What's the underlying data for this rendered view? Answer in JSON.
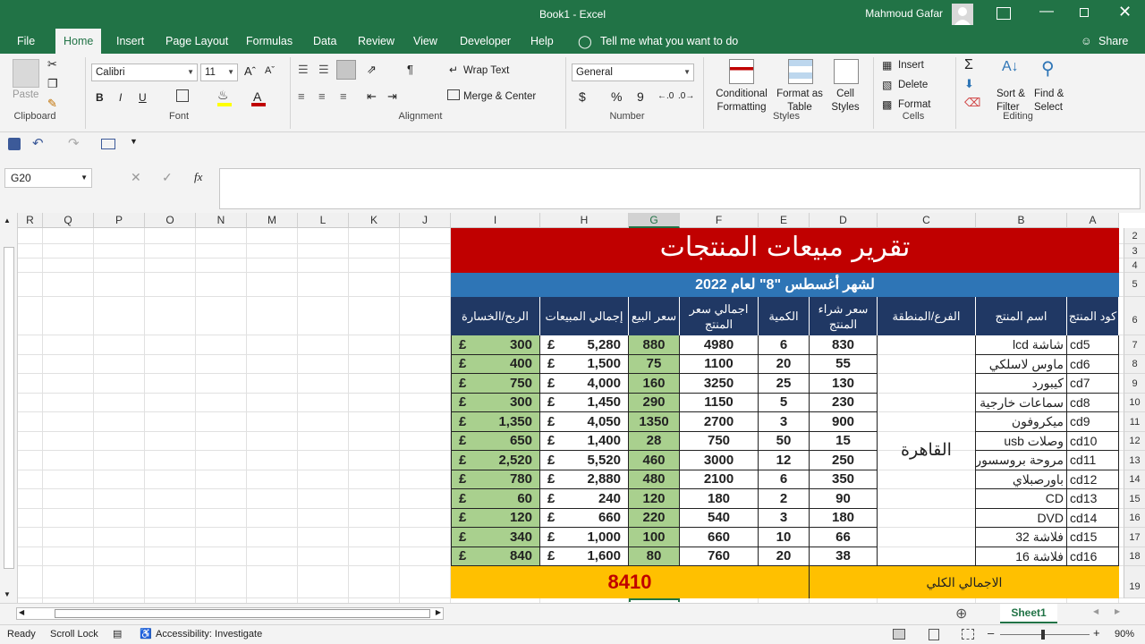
{
  "window": {
    "title": "Book1  -  Excel",
    "user": "Mahmoud Gafar"
  },
  "tabs": [
    "File",
    "Home",
    "Insert",
    "Page Layout",
    "Formulas",
    "Data",
    "Review",
    "View",
    "Developer",
    "Help"
  ],
  "tell_me": "Tell me what you want to do",
  "share": "Share",
  "ribbon": {
    "clipboard": {
      "label": "Clipboard",
      "paste": "Paste"
    },
    "font": {
      "label": "Font",
      "name": "Calibri",
      "size": "11",
      "bold": "B",
      "italic": "I",
      "underline": "U"
    },
    "alignment": {
      "label": "Alignment",
      "wrap": "Wrap Text",
      "merge": "Merge & Center"
    },
    "number": {
      "label": "Number",
      "format": "General",
      "currency": "$",
      "percent": "%",
      "comma": "9"
    },
    "styles": {
      "label": "Styles",
      "conditional": [
        "Conditional",
        "Formatting"
      ],
      "format_table": [
        "Format as",
        "Table"
      ],
      "cell_styles": [
        "Cell",
        "Styles"
      ]
    },
    "cells": {
      "label": "Cells",
      "insert": "Insert",
      "delete": "Delete",
      "format": "Format"
    },
    "editing": {
      "label": "Editing",
      "sort": [
        "Sort &",
        "Filter"
      ],
      "find": [
        "Find &",
        "Select"
      ]
    }
  },
  "name_box": "G20",
  "fx": "fx",
  "columns": [
    {
      "id": "R",
      "w": 28
    },
    {
      "id": "Q",
      "w": 57
    },
    {
      "id": "P",
      "w": 57
    },
    {
      "id": "O",
      "w": 57
    },
    {
      "id": "N",
      "w": 57
    },
    {
      "id": "M",
      "w": 57
    },
    {
      "id": "L",
      "w": 57
    },
    {
      "id": "K",
      "w": 57
    },
    {
      "id": "J",
      "w": 57
    },
    {
      "id": "I",
      "w": 100
    },
    {
      "id": "H",
      "w": 99
    },
    {
      "id": "G",
      "w": 57
    },
    {
      "id": "F",
      "w": 88
    },
    {
      "id": "E",
      "w": 57
    },
    {
      "id": "D",
      "w": 76
    },
    {
      "id": "C",
      "w": 110
    },
    {
      "id": "B",
      "w": 102
    },
    {
      "id": "A",
      "w": 58
    }
  ],
  "selected_column": "G",
  "report": {
    "title": "تقرير مبيعات المنتجات",
    "subtitle": "لشهر أغسطس \"8\" لعام 2022",
    "headers": {
      "A": "كود المنتج",
      "B": "اسم المنتج",
      "C": "الفرع/المنطقة",
      "D": "سعر شراء المنتج",
      "E": "الكمية",
      "F": "اجمالي سعر المنتج",
      "G": "سعر البيع",
      "H": "إجمالي المبيعات",
      "I": "الربح/الخسارة"
    },
    "branch": "القاهرة",
    "currency_symbol": "£",
    "rows": [
      {
        "code": "cd5",
        "name": "شاشة lcd",
        "buy": "830",
        "qty": "6",
        "total_buy": "4980",
        "sell": "880",
        "sales": "5,280",
        "profit": "300"
      },
      {
        "code": "cd6",
        "name": "ماوس لاسلكي",
        "buy": "55",
        "qty": "20",
        "total_buy": "1100",
        "sell": "75",
        "sales": "1,500",
        "profit": "400"
      },
      {
        "code": "cd7",
        "name": "كيبورد",
        "buy": "130",
        "qty": "25",
        "total_buy": "3250",
        "sell": "160",
        "sales": "4,000",
        "profit": "750"
      },
      {
        "code": "cd8",
        "name": "سماعات خارجية",
        "buy": "230",
        "qty": "5",
        "total_buy": "1150",
        "sell": "290",
        "sales": "1,450",
        "profit": "300"
      },
      {
        "code": "cd9",
        "name": "ميكروفون",
        "buy": "900",
        "qty": "3",
        "total_buy": "2700",
        "sell": "1350",
        "sales": "4,050",
        "profit": "1,350"
      },
      {
        "code": "cd10",
        "name": "وصلات usb",
        "buy": "15",
        "qty": "50",
        "total_buy": "750",
        "sell": "28",
        "sales": "1,400",
        "profit": "650"
      },
      {
        "code": "cd11",
        "name": "مروحة بروسسور",
        "buy": "250",
        "qty": "12",
        "total_buy": "3000",
        "sell": "460",
        "sales": "5,520",
        "profit": "2,520"
      },
      {
        "code": "cd12",
        "name": "باورصبلاي",
        "buy": "350",
        "qty": "6",
        "total_buy": "2100",
        "sell": "480",
        "sales": "2,880",
        "profit": "780"
      },
      {
        "code": "cd13",
        "name": "CD",
        "buy": "90",
        "qty": "2",
        "total_buy": "180",
        "sell": "120",
        "sales": "240",
        "profit": "60"
      },
      {
        "code": "cd14",
        "name": "DVD",
        "buy": "180",
        "qty": "3",
        "total_buy": "540",
        "sell": "220",
        "sales": "660",
        "profit": "120"
      },
      {
        "code": "cd15",
        "name": "فلاشة 32",
        "buy": "66",
        "qty": "10",
        "total_buy": "660",
        "sell": "100",
        "sales": "1,000",
        "profit": "340"
      },
      {
        "code": "cd16",
        "name": "فلاشة 16",
        "buy": "38",
        "qty": "20",
        "total_buy": "760",
        "sell": "80",
        "sales": "1,600",
        "profit": "840"
      }
    ],
    "total_label": "الاجمالي الكلي",
    "total_value": "8410"
  },
  "row_numbers": [
    "2",
    "3",
    "4",
    "5",
    "6",
    "7",
    "8",
    "9",
    "10",
    "11",
    "12",
    "13",
    "14",
    "15",
    "16",
    "17",
    "18",
    "19"
  ],
  "sheet_tab": "Sheet1",
  "status": {
    "ready": "Ready",
    "scroll_lock": "Scroll Lock",
    "accessibility": "Accessibility: Investigate",
    "zoom": "90%"
  },
  "colors": {
    "excel_green": "#217346",
    "title_red": "#c00000",
    "subtitle_blue": "#2e75b6",
    "header_navy": "#203864",
    "green_cells": "#a9d08e",
    "total_yellow": "#ffc000"
  }
}
